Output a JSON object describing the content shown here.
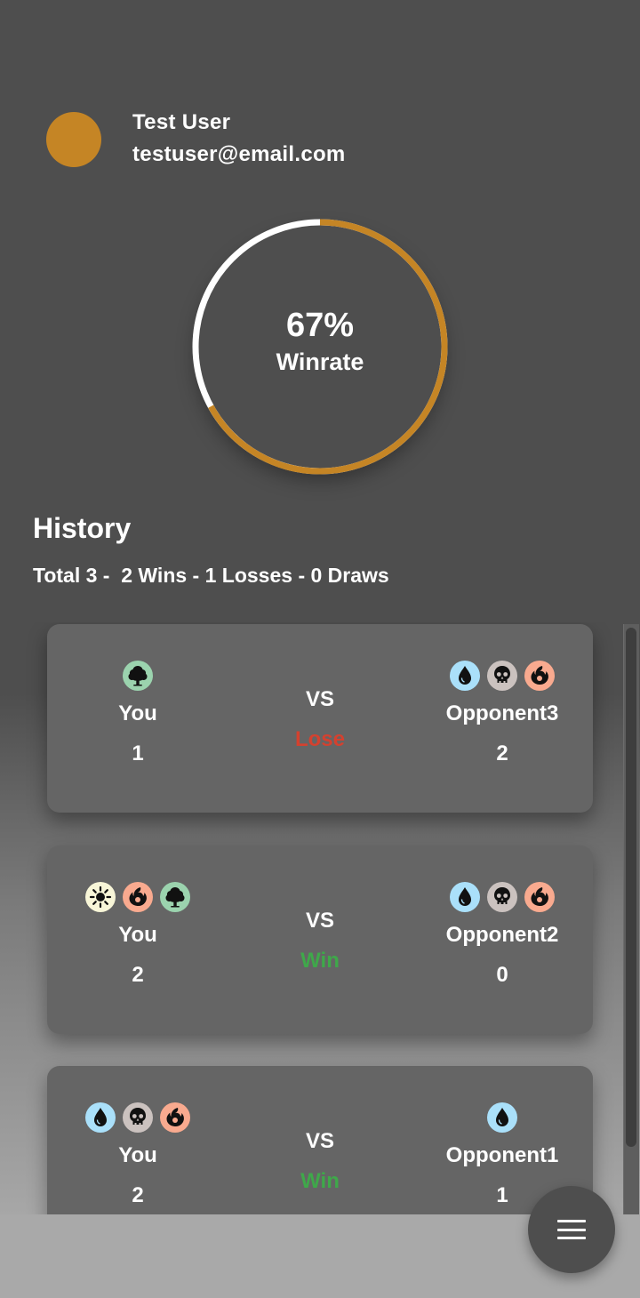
{
  "profile": {
    "name": "Test User",
    "email": "testuser@email.com",
    "avatar_color": "#c58525"
  },
  "winrate": {
    "percent_label": "67%",
    "label": "Winrate",
    "value": 0.67,
    "accent_color": "#c58525",
    "track_color": "#ffffff"
  },
  "history": {
    "title": "History",
    "summary": "Total 3 -  2 Wins - 1 Losses - 0 Draws"
  },
  "matches": [
    {
      "player_icons": [
        "green-mana-icon"
      ],
      "player_name": "You",
      "player_score": "1",
      "vs": "VS",
      "result": "Lose",
      "opponent_icons": [
        "blue-mana-icon",
        "black-mana-icon",
        "red-mana-icon"
      ],
      "opponent_name": "Opponent3",
      "opponent_score": "2"
    },
    {
      "player_icons": [
        "white-mana-icon",
        "red-mana-icon",
        "green-mana-icon"
      ],
      "player_name": "You",
      "player_score": "2",
      "vs": "VS",
      "result": "Win",
      "opponent_icons": [
        "blue-mana-icon",
        "black-mana-icon",
        "red-mana-icon"
      ],
      "opponent_name": "Opponent2",
      "opponent_score": "0"
    },
    {
      "player_icons": [
        "blue-mana-icon",
        "black-mana-icon",
        "red-mana-icon"
      ],
      "player_name": "You",
      "player_score": "2",
      "vs": "VS",
      "result": "Win",
      "opponent_icons": [
        "blue-mana-icon"
      ],
      "opponent_name": "Opponent1",
      "opponent_score": "1"
    }
  ],
  "colors": {
    "win": "#3fa84a",
    "lose": "#d4412f",
    "card": "#656565",
    "background": "#4e4e4e"
  },
  "fab": {
    "icon": "menu-icon"
  }
}
